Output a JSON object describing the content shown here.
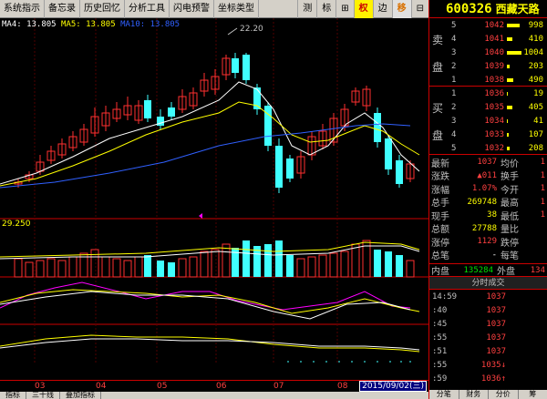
{
  "toolbar": {
    "items": [
      "系统指示",
      "备忘录",
      "历史回忆",
      "分析工具",
      "闪电预警",
      "坐标类型"
    ],
    "buttons": [
      "测",
      "标",
      "⊞",
      "权",
      "边",
      "移",
      "⊟"
    ]
  },
  "ma_legend": {
    "ma4": "MA4: 13.805",
    "ma5": "MA5: 13.805",
    "ma10": "MA10: 13.805"
  },
  "price_chart": {
    "high_label": "22.20",
    "vol_label": "29.250"
  },
  "x_axis": {
    "months": [
      "03",
      "04",
      "05",
      "06",
      "07",
      "08"
    ],
    "date": "2015/09/02(三)"
  },
  "left_tabs": [
    "指标",
    "三十线",
    "叠加指标"
  ],
  "stock": {
    "code": "600326",
    "name": "西藏天路"
  },
  "sell_label": "卖  盘",
  "buy_label": "买  盘",
  "sell_orders": [
    {
      "level": "5",
      "price": "1042",
      "vol": "998",
      "bar": 0.9
    },
    {
      "level": "4",
      "price": "1041",
      "vol": "410",
      "bar": 0.4
    },
    {
      "level": "3",
      "price": "1040",
      "vol": "1004",
      "bar": 1.0
    },
    {
      "level": "2",
      "price": "1039",
      "vol": "203",
      "bar": 0.2
    },
    {
      "level": "1",
      "price": "1038",
      "vol": "490",
      "bar": 0.45
    }
  ],
  "buy_orders": [
    {
      "level": "1",
      "price": "1036",
      "vol": "19",
      "bar": 0.05
    },
    {
      "level": "2",
      "price": "1035",
      "vol": "405",
      "bar": 0.4
    },
    {
      "level": "3",
      "price": "1034",
      "vol": "41",
      "bar": 0.05
    },
    {
      "level": "4",
      "price": "1033",
      "vol": "107",
      "bar": 0.1
    },
    {
      "level": "5",
      "price": "1032",
      "vol": "208",
      "bar": 0.2
    }
  ],
  "stats": [
    {
      "k": "最新",
      "v": "1037",
      "k2": "均价",
      "v2": "1"
    },
    {
      "k": "涨跌",
      "v": "▲011",
      "k2": "换手",
      "v2": "1"
    },
    {
      "k": "涨幅",
      "v": "1.07%",
      "k2": "今开",
      "v2": "1"
    },
    {
      "k": "总手",
      "v": "269748",
      "k2": "最高",
      "v2": "1"
    },
    {
      "k": "现手",
      "v": "38",
      "k2": "最低",
      "v2": "1"
    },
    {
      "k": "总额",
      "v": "27788",
      "k2": "量比",
      "v2": ""
    },
    {
      "k": "涨停",
      "v": "1129",
      "k2": "跌停",
      "v2": ""
    },
    {
      "k": "总笔",
      "v": "-",
      "k2": "每笔",
      "v2": ""
    }
  ],
  "inout": {
    "in_label": "内盘",
    "in_val": "135284",
    "out_label": "外盘",
    "out_val": "134"
  },
  "ts_title": "分时成交",
  "ticks": [
    {
      "t": "14:59",
      "p": "1037",
      "v": ""
    },
    {
      "t": ":40",
      "p": "1037",
      "v": ""
    },
    {
      "t": ":45",
      "p": "1037",
      "v": ""
    },
    {
      "t": ":55",
      "p": "1037",
      "v": ""
    },
    {
      "t": ":51",
      "p": "1037",
      "v": ""
    },
    {
      "t": ":55",
      "p": "1035↓",
      "v": ""
    },
    {
      "t": ":59",
      "p": "1036↑",
      "v": ""
    }
  ],
  "bottom_tabs": [
    "分笔",
    "财务",
    "分价",
    "筹"
  ]
}
